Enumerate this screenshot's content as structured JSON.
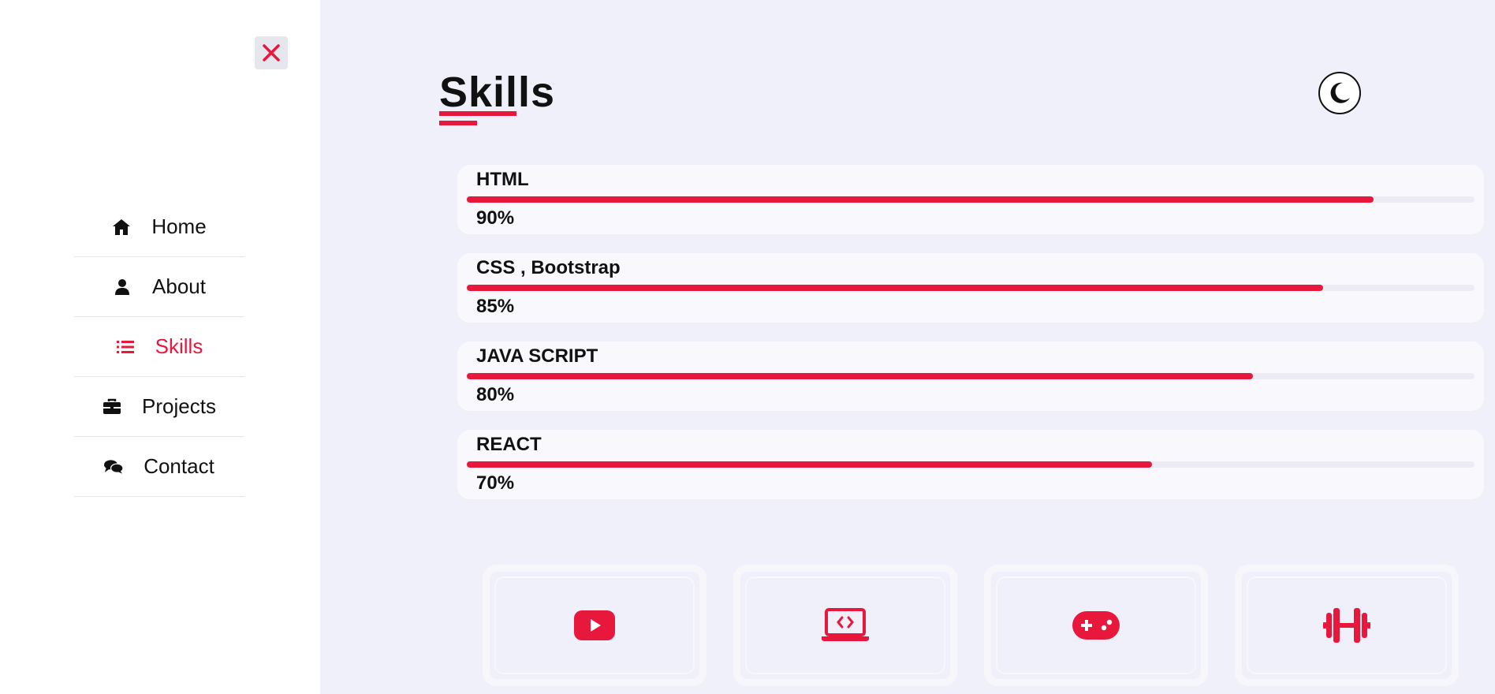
{
  "sidebar": {
    "close_icon": "close-icon",
    "items": [
      {
        "label": "Home",
        "icon": "home-icon"
      },
      {
        "label": "About",
        "icon": "user-icon"
      },
      {
        "label": "Skills",
        "icon": "list-icon",
        "active": true
      },
      {
        "label": "Projects",
        "icon": "briefcase-icon"
      },
      {
        "label": "Contact",
        "icon": "comments-icon"
      }
    ]
  },
  "header": {
    "title": "Skills",
    "theme_toggle_icon": "moon-icon"
  },
  "skills": [
    {
      "name": "HTML",
      "percent_label": "90%",
      "level": 0.9
    },
    {
      "name": "CSS , Bootstrap",
      "percent_label": "85%",
      "level": 0.85
    },
    {
      "name": "JAVA SCRIPT",
      "percent_label": "80%",
      "level": 0.78
    },
    {
      "name": "REACT",
      "percent_label": "70%",
      "level": 0.68
    }
  ],
  "interests": [
    {
      "icon": "youtube-icon"
    },
    {
      "icon": "laptop-code-icon"
    },
    {
      "icon": "gamepad-icon"
    },
    {
      "icon": "dumbbell-icon"
    }
  ],
  "colors": {
    "accent": "#e8173c",
    "background": "#f0f0fa",
    "sidebar": "#ffffff",
    "text": "#111111"
  }
}
